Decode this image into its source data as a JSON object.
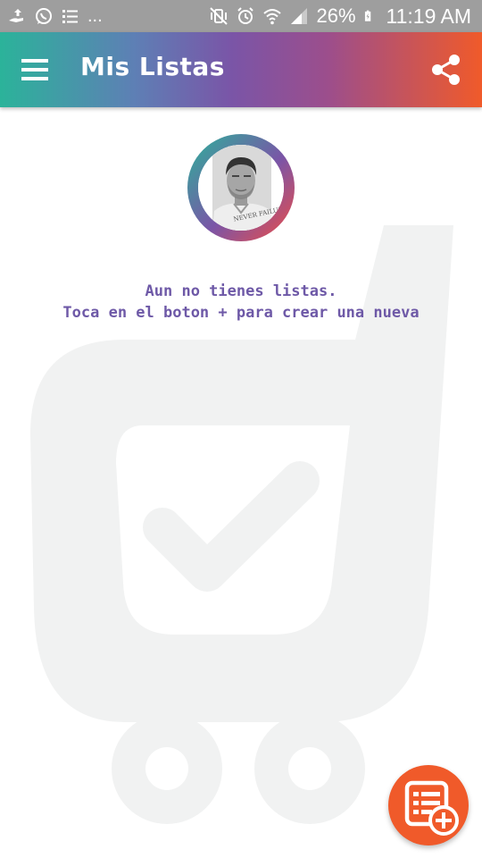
{
  "status_bar": {
    "left_text": "...",
    "battery": "26%",
    "time": "11:19 AM"
  },
  "app_bar": {
    "title": "Mis Listas",
    "menu_icon": "hamburger-menu-icon",
    "share_icon": "share-icon"
  },
  "empty_state": {
    "line1": "Aun no tienes listas.",
    "line2": "Toca en el boton + para crear una nueva"
  },
  "fab": {
    "icon": "add-list-icon"
  },
  "colors": {
    "status_bar": "#9e9e9e",
    "gradient_start": "#2bb39a",
    "gradient_mid": "#7a55a7",
    "gradient_end": "#f05a2a",
    "message_text": "#6e59a7",
    "fab": "#f05a2a",
    "watermark": "#f1f2f2"
  }
}
